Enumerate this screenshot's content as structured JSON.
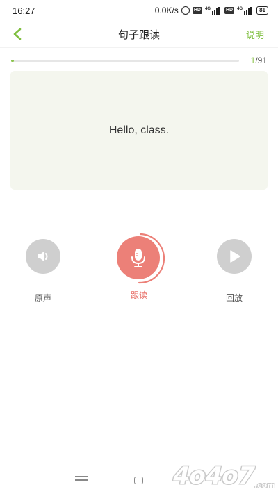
{
  "status_bar": {
    "time": "16:27",
    "net_speed": "0.0K/s",
    "hd1": "HD",
    "hd2": "HD",
    "net_type1": "4G",
    "net_type2": "4G",
    "battery": "81"
  },
  "nav": {
    "back_icon": "chevron-left-icon",
    "title": "句子跟读",
    "help_label": "说明"
  },
  "progress": {
    "current": "1",
    "separator_total": "/91",
    "fraction": 0.011
  },
  "card": {
    "sentence": "Hello, class."
  },
  "controls": {
    "origin_label": "原声",
    "record_label": "跟读",
    "replay_label": "回放",
    "record_color": "#ec8078",
    "icons": [
      "speaker-icon",
      "microphone-icon",
      "play-icon"
    ]
  },
  "bottom_nav": {
    "icons": [
      "menu-icon",
      "home-icon"
    ]
  },
  "watermark": {
    "text": "4o4o7.com"
  }
}
